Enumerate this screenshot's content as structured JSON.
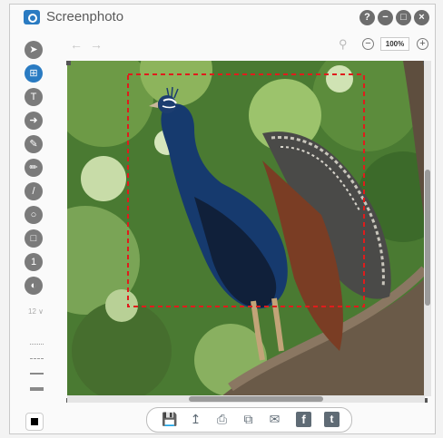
{
  "app": {
    "title": "Screenphoto"
  },
  "window_controls": {
    "help": "?",
    "minimize": "−",
    "maximize": "□",
    "close": "×"
  },
  "zoom": {
    "level": "100%"
  },
  "sidebar": {
    "font_size": "12 ∨",
    "active_tool": "crop"
  },
  "colors": {
    "accent": "#2a7bc2",
    "selection": "#e01c1c",
    "toolbar_icon": "#7b7b7b",
    "current_color": "#000000"
  },
  "icons": {
    "tools": [
      "arrow-icon",
      "crop-icon",
      "text-icon",
      "arrow-shape-icon",
      "brush-icon",
      "marker-icon",
      "line-icon",
      "ellipse-icon",
      "rectangle-icon",
      "number-icon",
      "blur-icon"
    ],
    "share": [
      "save-icon",
      "upload-icon",
      "print-icon",
      "copy-icon",
      "email-icon",
      "facebook-icon",
      "twitter-icon"
    ]
  }
}
